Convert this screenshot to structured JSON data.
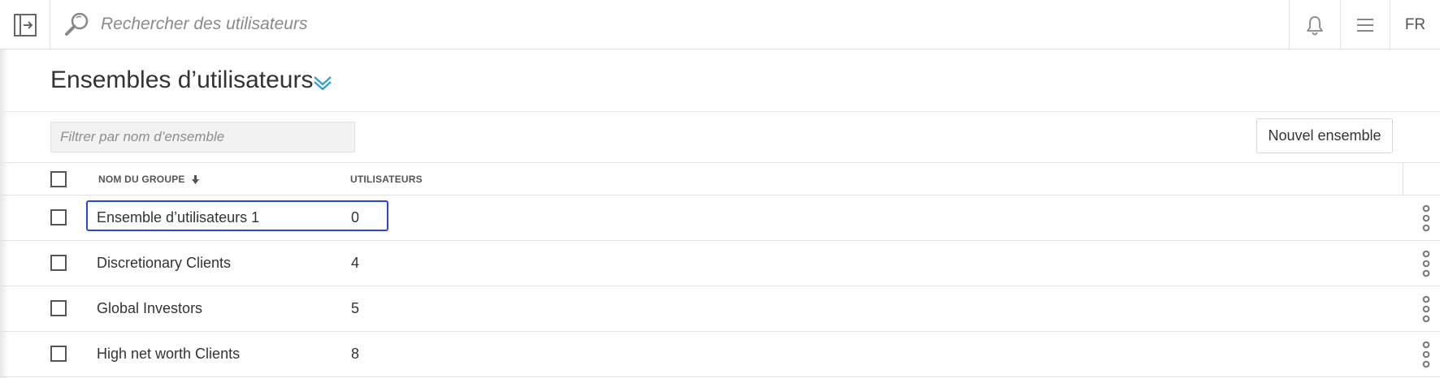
{
  "topbar": {
    "search_placeholder": "Rechercher des utilisateurs",
    "language": "FR"
  },
  "page": {
    "title": "Ensembles d’utilisateurs"
  },
  "filter": {
    "placeholder": "Filtrer par nom d’ensemble",
    "new_button": "Nouvel ensemble"
  },
  "table": {
    "columns": {
      "name": "NOM DU GROUPE",
      "users": "UTILISATEURS"
    },
    "rows": [
      {
        "name": "Ensemble d’utilisateurs 1",
        "users": "0"
      },
      {
        "name": "Discretionary Clients",
        "users": "4"
      },
      {
        "name": "Global Investors",
        "users": "5"
      },
      {
        "name": "High net worth Clients",
        "users": "8"
      }
    ]
  },
  "colors": {
    "accent": "#2f9bd9",
    "selection": "#2547e0"
  }
}
